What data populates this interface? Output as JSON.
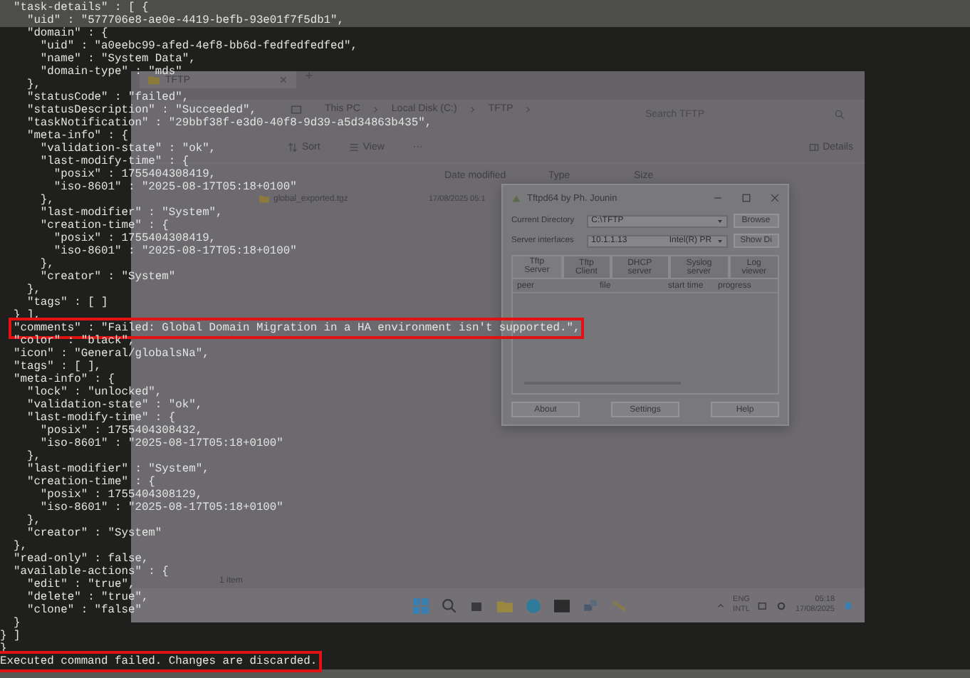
{
  "terminal": {
    "lines": [
      {
        "text": "  \"task-details\" : [ {",
        "highlighted": false
      },
      {
        "text": "    \"uid\" : \"577706e8-ae0e-4419-befb-93e01f7f5db1\",",
        "highlighted": false
      },
      {
        "text": "    \"domain\" : {",
        "highlighted": false
      },
      {
        "text": "      \"uid\" : \"a0eebc99-afed-4ef8-bb6d-fedfedfedfed\",",
        "highlighted": false
      },
      {
        "text": "      \"name\" : \"System Data\",",
        "highlighted": false
      },
      {
        "text": "      \"domain-type\" : \"mds\"",
        "highlighted": false
      },
      {
        "text": "    },",
        "highlighted": false
      },
      {
        "text": "    \"statusCode\" : \"failed\",",
        "highlighted": false
      },
      {
        "text": "    \"statusDescription\" : \"Succeeded\",",
        "highlighted": false
      },
      {
        "text": "    \"taskNotification\" : \"29bbf38f-e3d0-40f8-9d39-a5d34863b435\",",
        "highlighted": false
      },
      {
        "text": "    \"meta-info\" : {",
        "highlighted": false
      },
      {
        "text": "      \"validation-state\" : \"ok\",",
        "highlighted": false
      },
      {
        "text": "      \"last-modify-time\" : {",
        "highlighted": false
      },
      {
        "text": "        \"posix\" : 1755404308419,",
        "highlighted": false
      },
      {
        "text": "        \"iso-8601\" : \"2025-08-17T05:18+0100\"",
        "highlighted": false
      },
      {
        "text": "      },",
        "highlighted": false
      },
      {
        "text": "      \"last-modifier\" : \"System\",",
        "highlighted": false
      },
      {
        "text": "      \"creation-time\" : {",
        "highlighted": false
      },
      {
        "text": "        \"posix\" : 1755404308419,",
        "highlighted": false
      },
      {
        "text": "        \"iso-8601\" : \"2025-08-17T05:18+0100\"",
        "highlighted": false
      },
      {
        "text": "      },",
        "highlighted": false
      },
      {
        "text": "      \"creator\" : \"System\"",
        "highlighted": false
      },
      {
        "text": "    },",
        "highlighted": false
      },
      {
        "text": "    \"tags\" : [ ]",
        "highlighted": false
      },
      {
        "text": "  } ],",
        "highlighted": false
      },
      {
        "text": "  \"comments\" : \"Failed: Global Domain Migration in a HA environment isn't supported.\",",
        "highlighted": true
      },
      {
        "text": "  \"color\" : \"black\",",
        "highlighted": false
      },
      {
        "text": "  \"icon\" : \"General/globalsNa\",",
        "highlighted": false
      },
      {
        "text": "  \"tags\" : [ ],",
        "highlighted": false
      },
      {
        "text": "  \"meta-info\" : {",
        "highlighted": false
      },
      {
        "text": "    \"lock\" : \"unlocked\",",
        "highlighted": false
      },
      {
        "text": "    \"validation-state\" : \"ok\",",
        "highlighted": false
      },
      {
        "text": "    \"last-modify-time\" : {",
        "highlighted": false
      },
      {
        "text": "      \"posix\" : 1755404308432,",
        "highlighted": false
      },
      {
        "text": "      \"iso-8601\" : \"2025-08-17T05:18+0100\"",
        "highlighted": false
      },
      {
        "text": "    },",
        "highlighted": false
      },
      {
        "text": "    \"last-modifier\" : \"System\",",
        "highlighted": false
      },
      {
        "text": "    \"creation-time\" : {",
        "highlighted": false
      },
      {
        "text": "      \"posix\" : 1755404308129,",
        "highlighted": false
      },
      {
        "text": "      \"iso-8601\" : \"2025-08-17T05:18+0100\"",
        "highlighted": false
      },
      {
        "text": "    },",
        "highlighted": false
      },
      {
        "text": "    \"creator\" : \"System\"",
        "highlighted": false
      },
      {
        "text": "  },",
        "highlighted": false
      },
      {
        "text": "  \"read-only\" : false,",
        "highlighted": false
      },
      {
        "text": "  \"available-actions\" : {",
        "highlighted": false
      },
      {
        "text": "    \"edit\" : \"true\",",
        "highlighted": false
      },
      {
        "text": "    \"delete\" : \"true\",",
        "highlighted": false
      },
      {
        "text": "    \"clone\" : \"false\"",
        "highlighted": false
      },
      {
        "text": "  }",
        "highlighted": false
      },
      {
        "text": "} ]",
        "highlighted": false
      },
      {
        "text": "}",
        "highlighted": false
      },
      {
        "text": "Executed command failed. Changes are discarded.",
        "highlighted": true
      }
    ]
  },
  "desktop": {
    "explorer": {
      "tab_title": "TFTP",
      "breadcrumb": [
        "This PC",
        "Local Disk (C:)",
        "TFTP"
      ],
      "search": {
        "placeholder": "Search TFTP"
      },
      "toolbar": {
        "sort": "Sort",
        "view": "View",
        "more": "···",
        "details": "Details"
      },
      "columns": [
        "Date modified",
        "Type",
        "Size"
      ],
      "files": [
        {
          "name": "global_exported.tgz",
          "date_modified": "17/08/2025 05:1"
        }
      ],
      "status": "1 item"
    },
    "tftpd": {
      "title": "Tftpd64 by Ph. Jounin",
      "current_directory": {
        "label": "Current Directory",
        "value": "C:\\TFTP"
      },
      "browse": "Browse",
      "server_interfaces": {
        "label": "Server interfaces",
        "value": "10.1.1.13",
        "adapter": "Intel(R) PR"
      },
      "show_dir": "Show Di",
      "tabs": [
        {
          "label": "Tftp Server",
          "selected": true
        },
        {
          "label": "Tftp Client",
          "selected": false
        },
        {
          "label": "DHCP server",
          "selected": false
        },
        {
          "label": "Syslog server",
          "selected": false
        },
        {
          "label": "Log viewer",
          "selected": false
        }
      ],
      "columns": [
        "peer",
        "file",
        "start time",
        "progress"
      ],
      "buttons": [
        "About",
        "Settings",
        "Help"
      ]
    },
    "taskbar": {
      "language": "ENG",
      "layout": "INTL",
      "time": "05:18",
      "date": "17/08/2025"
    }
  }
}
